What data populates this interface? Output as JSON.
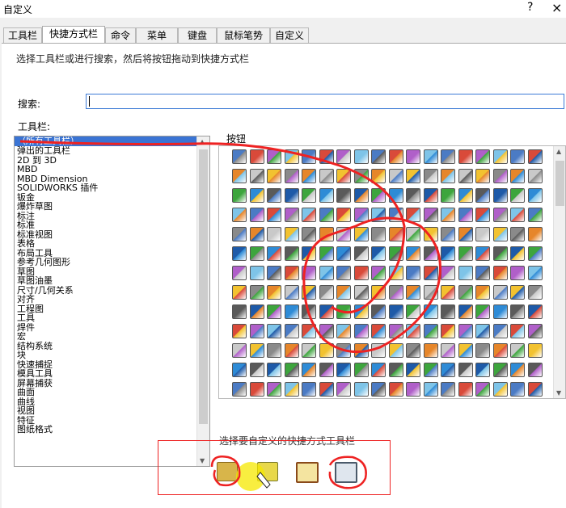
{
  "window": {
    "title": "自定义",
    "help": "?",
    "close": "×"
  },
  "tabs": [
    "工具栏",
    "快捷方式栏",
    "命令",
    "菜单",
    "键盘",
    "鼠标笔势",
    "自定义"
  ],
  "active_tab": 1,
  "instruction": "选择工具栏或进行搜索，然后将按钮拖动到快捷方式栏",
  "search": {
    "label": "搜索:",
    "value": ""
  },
  "toolbar_list": {
    "label": "工具栏:",
    "items": [
      "（所有工具栏）",
      "弹出的工具栏",
      "2D 到 3D",
      "MBD",
      "MBD Dimension",
      "SOLIDWORKS 插件",
      "钣金",
      "爆炸草图",
      "标注",
      "标准",
      "标准视图",
      "表格",
      "布局工具",
      "参考几何图形",
      "草图",
      "草图油墨",
      "尺寸/几何关系",
      "对齐",
      "工程图",
      "工具",
      "焊件",
      "宏",
      "结构系统",
      "块",
      "快速捕捉",
      "模具工具",
      "屏幕捕获",
      "曲面",
      "曲线",
      "视图",
      "特征",
      "图纸格式"
    ],
    "selected": 0
  },
  "buttons_label": "按钮",
  "bottom_label": "选择要自定义的快捷方式工具栏",
  "colors": {
    "selection": "#3a74d4",
    "annotation": "#e22222",
    "highlight": "#f5e800"
  }
}
